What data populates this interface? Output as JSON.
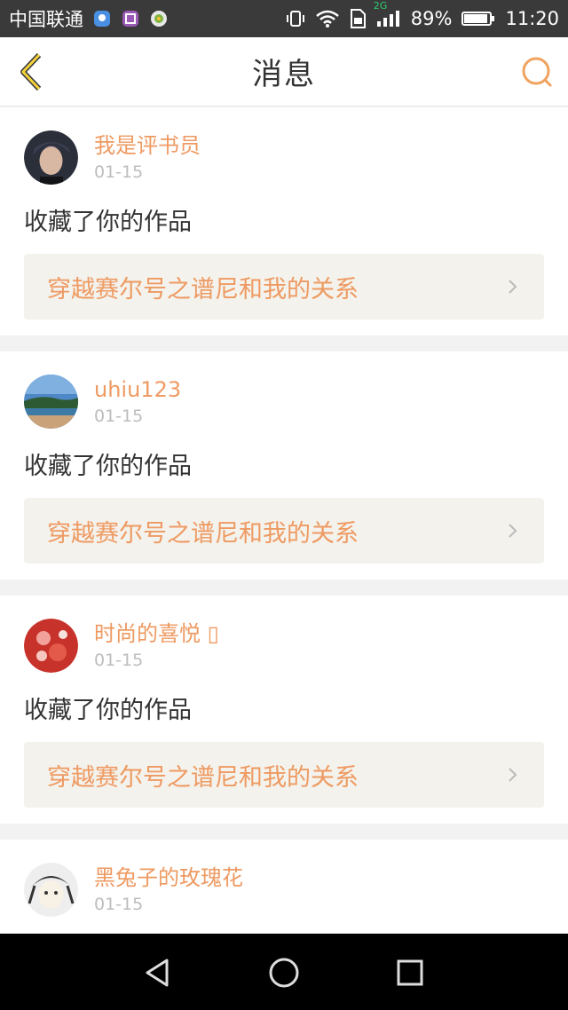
{
  "status_bar": {
    "carrier": "中国联通",
    "battery_pct": "89%",
    "time": "11:20",
    "network": "2G",
    "icons": [
      "location-icon",
      "gallery-icon",
      "app-icon",
      "vibrate-icon",
      "wifi-icon",
      "sim-icon",
      "signal-icon",
      "battery-icon"
    ]
  },
  "header": {
    "title": "消息",
    "accent": "#f0a35e"
  },
  "messages": [
    {
      "username": "我是评书员",
      "date": "01-15",
      "action": "收藏了你的作品",
      "work_title": "穿越赛尔号之谱尼和我的关系"
    },
    {
      "username": "uhiu123",
      "date": "01-15",
      "action": "收藏了你的作品",
      "work_title": "穿越赛尔号之谱尼和我的关系"
    },
    {
      "username": "时尚的喜悦 ▯",
      "date": "01-15",
      "action": "收藏了你的作品",
      "work_title": "穿越赛尔号之谱尼和我的关系"
    },
    {
      "username": "黑兔子的玫瑰花",
      "date": "01-15"
    }
  ],
  "nav": {
    "icons": [
      "back-triangle-icon",
      "home-circle-icon",
      "recents-square-icon"
    ]
  }
}
